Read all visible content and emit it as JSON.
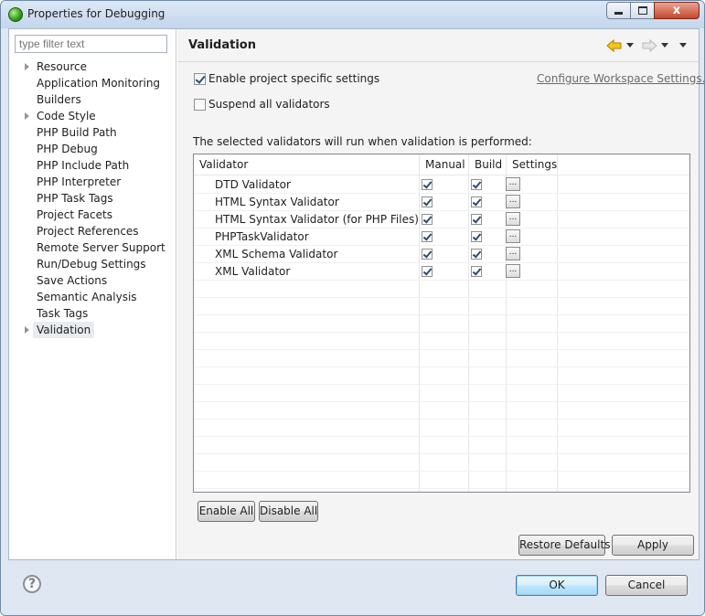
{
  "window": {
    "title": "Properties for Debugging",
    "close_glyph": "x"
  },
  "filter": {
    "placeholder": "type filter text"
  },
  "tree": {
    "items": [
      {
        "label": "Resource",
        "expandable": true
      },
      {
        "label": "Application Monitoring",
        "expandable": false
      },
      {
        "label": "Builders",
        "expandable": false
      },
      {
        "label": "Code Style",
        "expandable": true
      },
      {
        "label": "PHP Build Path",
        "expandable": false
      },
      {
        "label": "PHP Debug",
        "expandable": false
      },
      {
        "label": "PHP Include Path",
        "expandable": false
      },
      {
        "label": "PHP Interpreter",
        "expandable": false
      },
      {
        "label": "PHP Task Tags",
        "expandable": false
      },
      {
        "label": "Project Facets",
        "expandable": false
      },
      {
        "label": "Project References",
        "expandable": false
      },
      {
        "label": "Remote Server Support",
        "expandable": false
      },
      {
        "label": "Run/Debug Settings",
        "expandable": false
      },
      {
        "label": "Save Actions",
        "expandable": false
      },
      {
        "label": "Semantic Analysis",
        "expandable": false
      },
      {
        "label": "Task Tags",
        "expandable": false
      },
      {
        "label": "Validation",
        "expandable": true,
        "selected": true
      }
    ]
  },
  "page": {
    "title": "Validation",
    "enable_project_specific": {
      "label": "Enable project specific settings",
      "checked": true
    },
    "configure_link": "Configure Workspace Settings...",
    "suspend_all": {
      "label": "Suspend all validators",
      "checked": false
    },
    "description": "The selected validators will run when validation is performed:",
    "table": {
      "columns": [
        "Validator",
        "Manual",
        "Build",
        "Settings"
      ],
      "rows": [
        {
          "name": "DTD Validator",
          "manual": true,
          "build": true,
          "settings": "..."
        },
        {
          "name": "HTML Syntax Validator",
          "manual": true,
          "build": true,
          "settings": "..."
        },
        {
          "name": "HTML Syntax Validator (for PHP Files)",
          "manual": true,
          "build": true,
          "settings": "..."
        },
        {
          "name": "PHPTaskValidator",
          "manual": true,
          "build": true,
          "settings": "..."
        },
        {
          "name": "XML Schema Validator",
          "manual": true,
          "build": true,
          "settings": "..."
        },
        {
          "name": "XML Validator",
          "manual": true,
          "build": true,
          "settings": "..."
        }
      ]
    },
    "enable_all": "Enable All",
    "disable_all": "Disable All",
    "restore_defaults": "Restore Defaults",
    "apply": "Apply"
  },
  "footer": {
    "help_glyph": "?",
    "ok": "OK",
    "cancel": "Cancel"
  },
  "icons": {
    "back": "back-arrow-icon",
    "forward": "forward-arrow-icon",
    "menu": "view-menu-icon",
    "accent_back": "#f0b400"
  }
}
